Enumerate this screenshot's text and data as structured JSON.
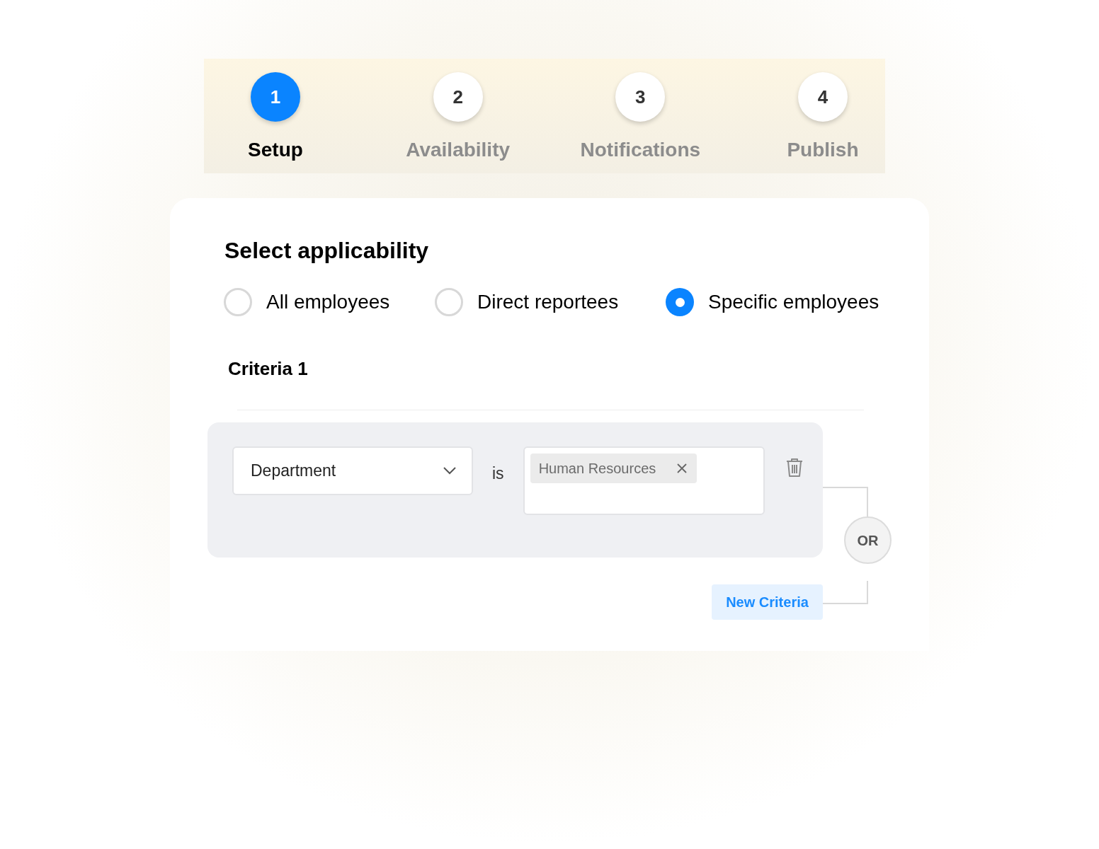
{
  "steps": [
    {
      "number": "1",
      "label": "Setup",
      "selected": true
    },
    {
      "number": "2",
      "label": "Availability",
      "selected": false
    },
    {
      "number": "3",
      "label": "Notifications",
      "selected": false
    },
    {
      "number": "4",
      "label": "Publish",
      "selected": false
    }
  ],
  "title": "Select applicability",
  "options": [
    {
      "label": "All employees",
      "selected": false
    },
    {
      "label": "Direct reportees",
      "selected": false
    },
    {
      "label": "Specific employees",
      "selected": true
    }
  ],
  "criteria": {
    "title": "Criteria 1",
    "field": "Department",
    "operator": "is",
    "tags": [
      "Human Resources"
    ]
  },
  "or_label": "OR",
  "new_criteria": "New Criteria"
}
